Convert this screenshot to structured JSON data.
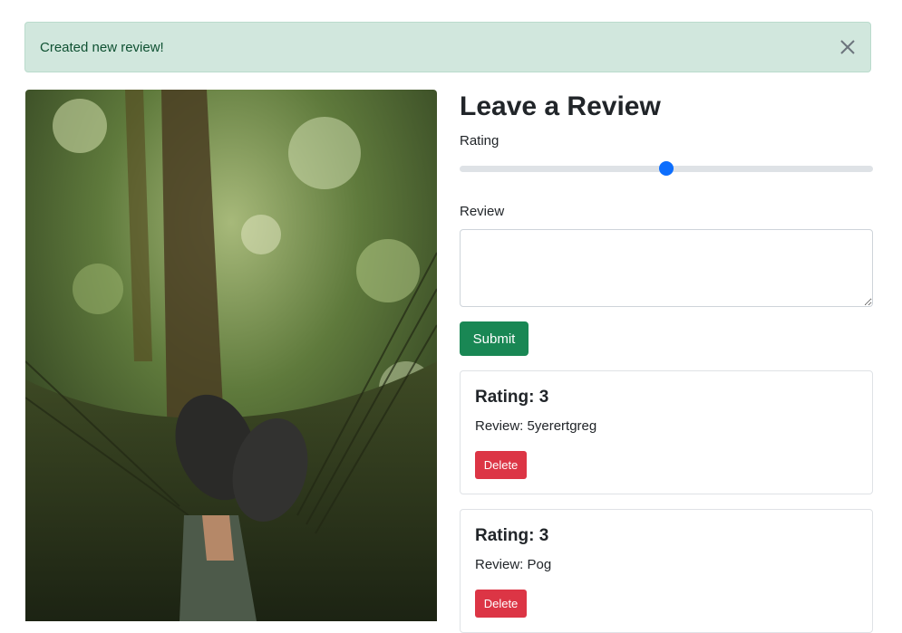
{
  "alert": {
    "message": "Created new review!",
    "close_icon": "close-icon"
  },
  "photo": {
    "alt": "Feet in a hammock under trees"
  },
  "form": {
    "heading": "Leave a Review",
    "rating_label": "Rating",
    "rating_value": 3,
    "rating_min": 1,
    "rating_max": 5,
    "review_label": "Review",
    "review_value": "",
    "submit_label": "Submit"
  },
  "reviews": [
    {
      "title": "Rating: 3",
      "text": "Review: 5yerertgreg",
      "delete_label": "Delete"
    },
    {
      "title": "Rating: 3",
      "text": "Review: Pog",
      "delete_label": "Delete"
    }
  ],
  "colors": {
    "alert_bg": "#d1e7dd",
    "alert_text": "#0f5132",
    "accent": "#0d6efd",
    "success": "#198754",
    "danger": "#dc3545"
  }
}
